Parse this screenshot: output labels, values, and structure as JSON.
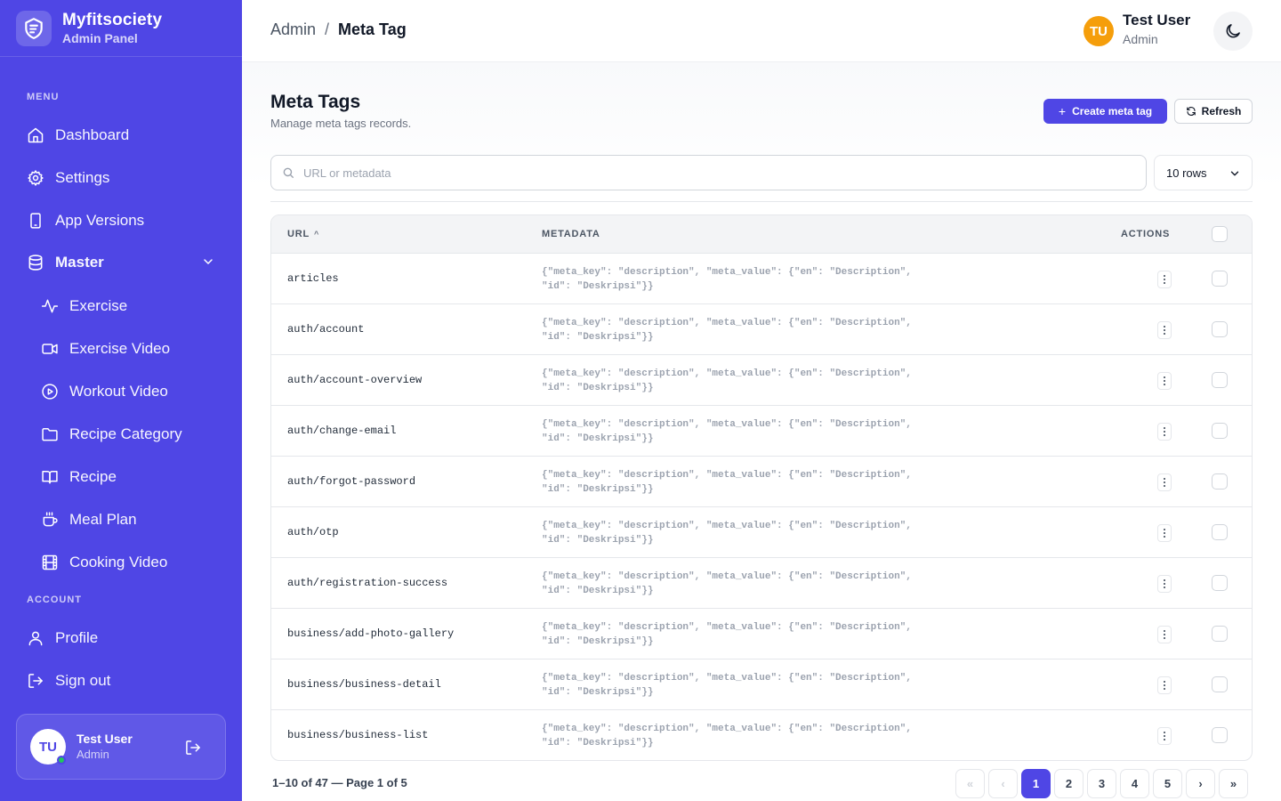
{
  "brand": {
    "name": "Myfitsociety",
    "subtitle": "Admin Panel"
  },
  "sidebar": {
    "menu_label": "MENU",
    "account_label": "ACCOUNT",
    "items": [
      {
        "label": "Dashboard",
        "icon": "home-icon"
      },
      {
        "label": "Settings",
        "icon": "gear-icon"
      },
      {
        "label": "App Versions",
        "icon": "smartphone-icon"
      },
      {
        "label": "Master",
        "icon": "database-icon",
        "expanded": true
      },
      {
        "label": "Exercise",
        "icon": "activity-icon"
      },
      {
        "label": "Exercise Video",
        "icon": "video-camera-icon"
      },
      {
        "label": "Workout Video",
        "icon": "play-circle-icon"
      },
      {
        "label": "Recipe Category",
        "icon": "folder-icon"
      },
      {
        "label": "Recipe",
        "icon": "book-open-icon"
      },
      {
        "label": "Meal Plan",
        "icon": "coffee-cup-icon"
      },
      {
        "label": "Cooking Video",
        "icon": "film-icon"
      }
    ],
    "account_items": [
      {
        "label": "Profile",
        "icon": "user-icon"
      },
      {
        "label": "Sign out",
        "icon": "logout-icon"
      }
    ],
    "user": {
      "initials": "TU",
      "name": "Test User",
      "role": "Admin"
    }
  },
  "header": {
    "breadcrumb": {
      "parent": "Admin",
      "separator": "/",
      "current": "Meta Tag"
    },
    "user": {
      "initials": "TU",
      "name": "Test User",
      "role": "Admin"
    }
  },
  "main": {
    "title": "Meta Tags",
    "subtitle": "Manage meta tags records.",
    "create_label": "Create meta tag",
    "refresh_label": "Refresh",
    "search_placeholder": "URL or metadata",
    "rows_option": "10 rows"
  },
  "table": {
    "columns": {
      "url": "URL",
      "sort": "^",
      "metadata": "METADATA",
      "actions": "ACTIONS"
    },
    "rows": [
      {
        "url": "articles",
        "meta_line1": "{\"meta_key\": \"description\", \"meta_value\": {\"en\": \"Description\",",
        "meta_line2": "\"id\": \"Deskripsi\"}}"
      },
      {
        "url": "auth/account",
        "meta_line1": "{\"meta_key\": \"description\", \"meta_value\": {\"en\": \"Description\",",
        "meta_line2": "\"id\": \"Deskripsi\"}}"
      },
      {
        "url": "auth/account-overview",
        "meta_line1": "{\"meta_key\": \"description\", \"meta_value\": {\"en\": \"Description\",",
        "meta_line2": "\"id\": \"Deskripsi\"}}"
      },
      {
        "url": "auth/change-email",
        "meta_line1": "{\"meta_key\": \"description\", \"meta_value\": {\"en\": \"Description\",",
        "meta_line2": "\"id\": \"Deskripsi\"}}"
      },
      {
        "url": "auth/forgot-password",
        "meta_line1": "{\"meta_key\": \"description\", \"meta_value\": {\"en\": \"Description\",",
        "meta_line2": "\"id\": \"Deskripsi\"}}"
      },
      {
        "url": "auth/otp",
        "meta_line1": "{\"meta_key\": \"description\", \"meta_value\": {\"en\": \"Description\",",
        "meta_line2": "\"id\": \"Deskripsi\"}}"
      },
      {
        "url": "auth/registration-success",
        "meta_line1": "{\"meta_key\": \"description\", \"meta_value\": {\"en\": \"Description\",",
        "meta_line2": "\"id\": \"Deskripsi\"}}"
      },
      {
        "url": "business/add-photo-gallery",
        "meta_line1": "{\"meta_key\": \"description\", \"meta_value\": {\"en\": \"Description\",",
        "meta_line2": "\"id\": \"Deskripsi\"}}"
      },
      {
        "url": "business/business-detail",
        "meta_line1": "{\"meta_key\": \"description\", \"meta_value\": {\"en\": \"Description\",",
        "meta_line2": "\"id\": \"Deskripsi\"}}"
      },
      {
        "url": "business/business-list",
        "meta_line1": "{\"meta_key\": \"description\", \"meta_value\": {\"en\": \"Description\",",
        "meta_line2": "\"id\": \"Deskripsi\"}}"
      }
    ]
  },
  "pagination": {
    "info": "1–10 of 47 — Page 1 of 5",
    "first": "«",
    "prev": "‹",
    "next": "›",
    "last": "»",
    "pages": [
      "1",
      "2",
      "3",
      "4",
      "5"
    ],
    "current_page": "1"
  },
  "colors": {
    "accent": "#4f46e5",
    "avatar_header": "#f59e0b",
    "online": "#22c55e"
  }
}
